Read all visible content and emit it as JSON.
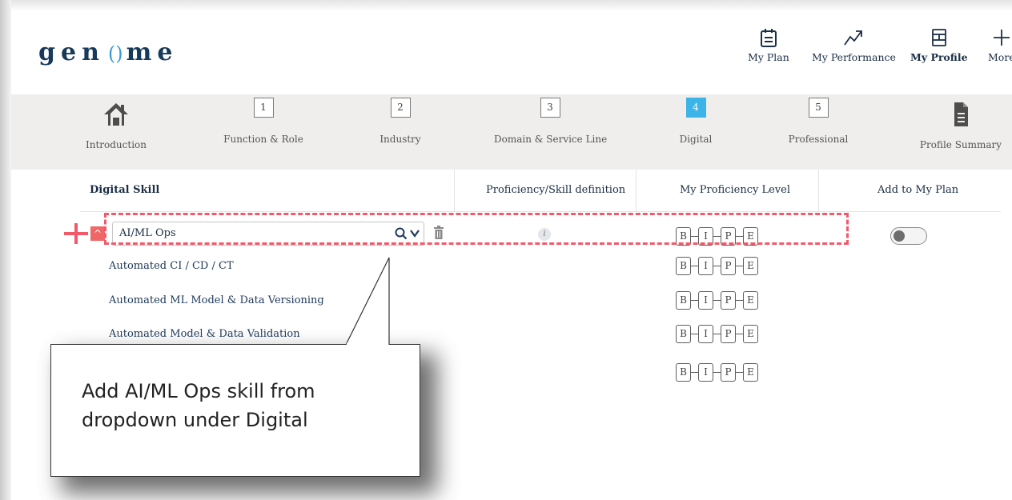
{
  "brand": {
    "logo_pre": "gen",
    "logo_o": "()",
    "logo_post": "me"
  },
  "topnav": [
    {
      "label": "My Plan",
      "icon": "calendar-icon"
    },
    {
      "label": "My Performance",
      "icon": "trend-arrow-icon"
    },
    {
      "label": "My Profile",
      "icon": "profile-grid-icon",
      "active": true
    },
    {
      "label": "More",
      "icon": "plus-icon"
    }
  ],
  "steps": [
    {
      "label": "Introduction",
      "icon": "home-icon"
    },
    {
      "num": "1",
      "label": "Function & Role"
    },
    {
      "num": "2",
      "label": "Industry"
    },
    {
      "num": "3",
      "label": "Domain & Service Line"
    },
    {
      "num": "4",
      "label": "Digital",
      "active": true
    },
    {
      "num": "5",
      "label": "Professional"
    },
    {
      "label": "Profile Summary",
      "icon": "document-icon"
    }
  ],
  "table": {
    "headers": [
      "Digital Skill",
      "Proficiency/Skill definition",
      "My Proficiency Level",
      "Add to My Plan"
    ],
    "selected_skill": "AI/ML Ops",
    "info_glyph": "i",
    "levels": [
      "B",
      "I",
      "P",
      "E"
    ],
    "sub_skills": [
      "Automated CI / CD / CT",
      "Automated ML Model & Data Versioning",
      "Automated Model & Data Validation"
    ]
  },
  "callout": {
    "text": "Add AI/ML Ops skill from dropdown under Digital"
  },
  "colors": {
    "accent": "#3db4e8",
    "annotation": "#f25a6a",
    "brand": "#183a5a"
  }
}
